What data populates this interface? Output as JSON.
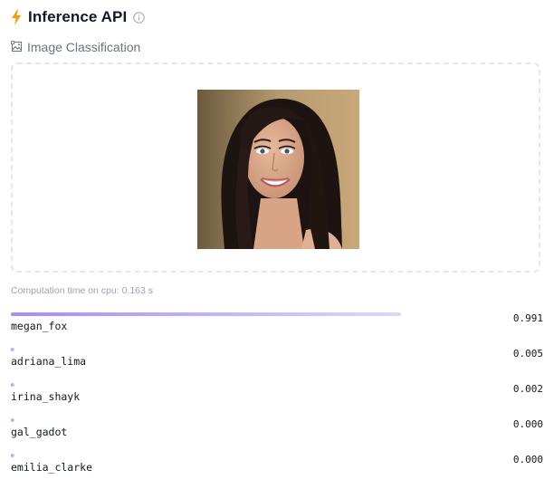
{
  "header": {
    "title": "Inference API",
    "bolt_icon": "lightning-bolt-icon",
    "info_icon": "info-icon",
    "accent_color": "#f59e0b"
  },
  "task": {
    "label": "Image Classification",
    "icon": "image-classification-icon"
  },
  "dropzone": {
    "image_alt": "Uploaded photo of a smiling woman with long dark hair"
  },
  "computation": {
    "text": "Computation time on cpu: 0.163 s"
  },
  "results": [
    {
      "label": "megan_fox",
      "score": "0.991",
      "value": 0.991
    },
    {
      "label": "adriana_lima",
      "score": "0.005",
      "value": 0.005
    },
    {
      "label": "irina_shayk",
      "score": "0.002",
      "value": 0.002
    },
    {
      "label": "gal_gadot",
      "score": "0.000",
      "value": 0.0
    },
    {
      "label": "emilia_clarke",
      "score": "0.000",
      "value": 0.0
    }
  ],
  "colors": {
    "bar_start": "#a78bfa",
    "bar_end": "#ddd6fe",
    "muted_text": "#6b7280",
    "border": "#e5e7eb"
  }
}
